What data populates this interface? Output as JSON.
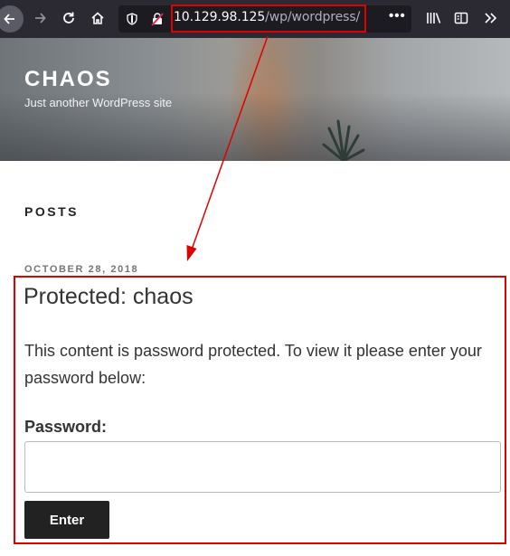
{
  "browser": {
    "url_host": "10.129.98.125",
    "url_path": "/wp/wordpress/",
    "url_menu": "•••",
    "icons": [
      "back-icon",
      "forward-icon",
      "reload-icon",
      "home-icon",
      "shield-icon",
      "insecure-lock-icon",
      "library-icon",
      "reader-view-icon",
      "overflow-menu-icon"
    ]
  },
  "site": {
    "title": "CHAOS",
    "description": "Just another WordPress site"
  },
  "content": {
    "section_heading": "POSTS",
    "post_date": "OCTOBER 28, 2018",
    "post_title": "Protected: chaos",
    "post_text": "This content is password protected. To view it please enter your password below:",
    "password_label": "Password:",
    "password_value": "",
    "enter_label": "Enter"
  },
  "annotations": {
    "highlight_color": "#e00000"
  }
}
